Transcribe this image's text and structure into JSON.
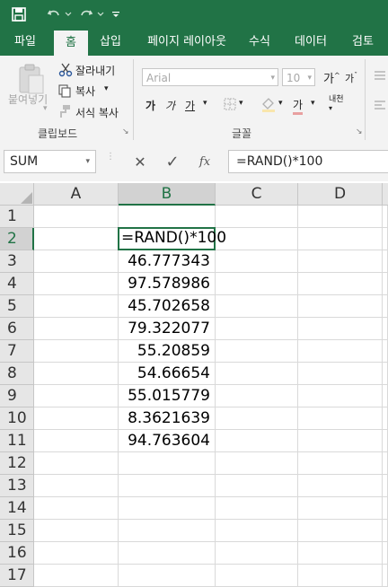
{
  "app": {
    "accent": "#217346"
  },
  "tabs": [
    "파일",
    "홈",
    "삽입",
    "페이지 레이아웃",
    "수식",
    "데이터",
    "검토"
  ],
  "active_tab": "홈",
  "ribbon": {
    "clipboard": {
      "paste_label": "붙여넣기",
      "cut_label": "잘라내기",
      "copy_label": "복사",
      "format_painter_label": "서식 복사",
      "group_label": "클립보드"
    },
    "font": {
      "font_name": "Arial",
      "font_size": "10",
      "group_label": "글꼴",
      "grow_glyph": "가",
      "shrink_glyph": "가",
      "bold_glyph": "가",
      "italic_glyph": "가",
      "underline_glyph": "가",
      "fontcolor_glyph": "가",
      "phonetic_label": "내천"
    }
  },
  "formula_bar": {
    "name_box": "SUM",
    "cancel_glyph": "✕",
    "enter_glyph": "✓",
    "fx_glyph": "fx",
    "formula": "=RAND()*100"
  },
  "grid": {
    "columns": [
      "A",
      "B",
      "C",
      "D"
    ],
    "selected_column": "B",
    "rows": [
      {
        "n": "1",
        "b": ""
      },
      {
        "n": "2",
        "b": "=RAND()*100"
      },
      {
        "n": "3",
        "b": "46.777343"
      },
      {
        "n": "4",
        "b": "97.578986"
      },
      {
        "n": "5",
        "b": "45.702658"
      },
      {
        "n": "6",
        "b": "79.322077"
      },
      {
        "n": "7",
        "b": "55.20859"
      },
      {
        "n": "8",
        "b": "54.66654"
      },
      {
        "n": "9",
        "b": "55.015779"
      },
      {
        "n": "10",
        "b": "8.3621639"
      },
      {
        "n": "11",
        "b": "94.763604"
      },
      {
        "n": "12",
        "b": ""
      },
      {
        "n": "13",
        "b": ""
      },
      {
        "n": "14",
        "b": ""
      },
      {
        "n": "15",
        "b": ""
      },
      {
        "n": "16",
        "b": ""
      },
      {
        "n": "17",
        "b": ""
      }
    ],
    "selected_row": "2"
  }
}
